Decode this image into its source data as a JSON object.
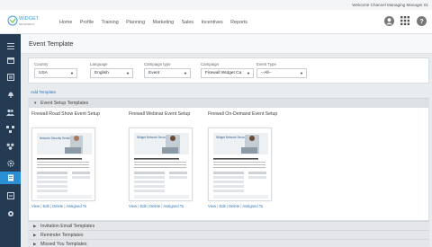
{
  "header": {
    "welcome": "Welcome Channel Managing Manager 01",
    "logo_text": "WIDGET",
    "logo_sub": "NETWORKS",
    "nav": [
      "Home",
      "Profile",
      "Training",
      "Planning",
      "Marketing",
      "Sales",
      "Incentives",
      "Reports"
    ],
    "icons": [
      "user-icon",
      "grid-icon",
      "help-icon"
    ]
  },
  "sidebar": {
    "items": [
      "menu-icon",
      "calendar-icon",
      "folder-icon",
      "bell-icon",
      "users-icon",
      "network-icon",
      "settings-icon",
      "gear-icon",
      "template-icon",
      "file-icon",
      "tools-icon"
    ],
    "active_index": 8
  },
  "page": {
    "title": "Event Template",
    "add_link": "Add Template"
  },
  "filters": [
    {
      "label": "Country",
      "value": "USA"
    },
    {
      "label": "Language",
      "value": "English"
    },
    {
      "label": "Campaign type",
      "value": "Event"
    },
    {
      "label": "Campaign",
      "value": "Firewall Widget Ca"
    },
    {
      "label": "Event Type",
      "value": "--All--"
    }
  ],
  "sections": {
    "event_setup": "Event Setup Templates",
    "invitation": "Invitation Email Templates",
    "reminder": "Reminder Templates",
    "missed": "Missed You Templates"
  },
  "templates": [
    {
      "title": "Firewall Road Show Event Setup",
      "thumb_heading": "Network Security Seminar"
    },
    {
      "title": "Firewall Webinar Event Setup",
      "thumb_heading": "Widget Network Security Webinar"
    },
    {
      "title": "Firewall On-Demand Event Setup",
      "thumb_heading": "Widget Network Security Webinar"
    }
  ],
  "actions": {
    "view": "View",
    "edit": "Edit",
    "delete": "Delete",
    "assigned": "Assigned To"
  },
  "colors": {
    "sidebar": "#243b53",
    "active": "#2b8fd6",
    "link": "#2b72b8"
  }
}
